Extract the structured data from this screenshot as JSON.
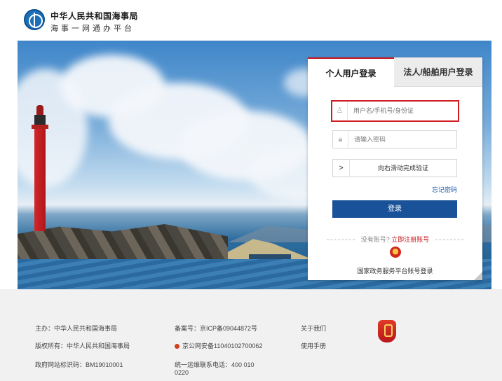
{
  "header": {
    "org_name": "中华人民共和国海事局",
    "subtitle": "海事一网通办平台"
  },
  "login": {
    "tab_personal": "个人用户登录",
    "tab_corporate": "法人/船舶用户登录",
    "username_placeholder": "用户名/手机号/身份证",
    "password_placeholder": "请输入密码",
    "slider_handle": ">",
    "slider_text": "向右滑动完成验证",
    "forgot_password": "忘记密码",
    "login_button": "登录",
    "no_account": "没有账号?",
    "register": "立即注册账号",
    "gov_login": "国家政务服务平台账号登录"
  },
  "footer": {
    "sponsor": "主办：中华人民共和国海事局",
    "copyright": "版权所有：中华人民共和国海事局",
    "site_id": "政府网站标识码：BM19010001",
    "icp": "备案号：京ICP备09044872号",
    "police": "京公网安备11040102700062",
    "hotline_line1": "统一运维联系电话：400 010",
    "hotline_line2": "0220",
    "about": "关于我们",
    "manual": "使用手册"
  }
}
